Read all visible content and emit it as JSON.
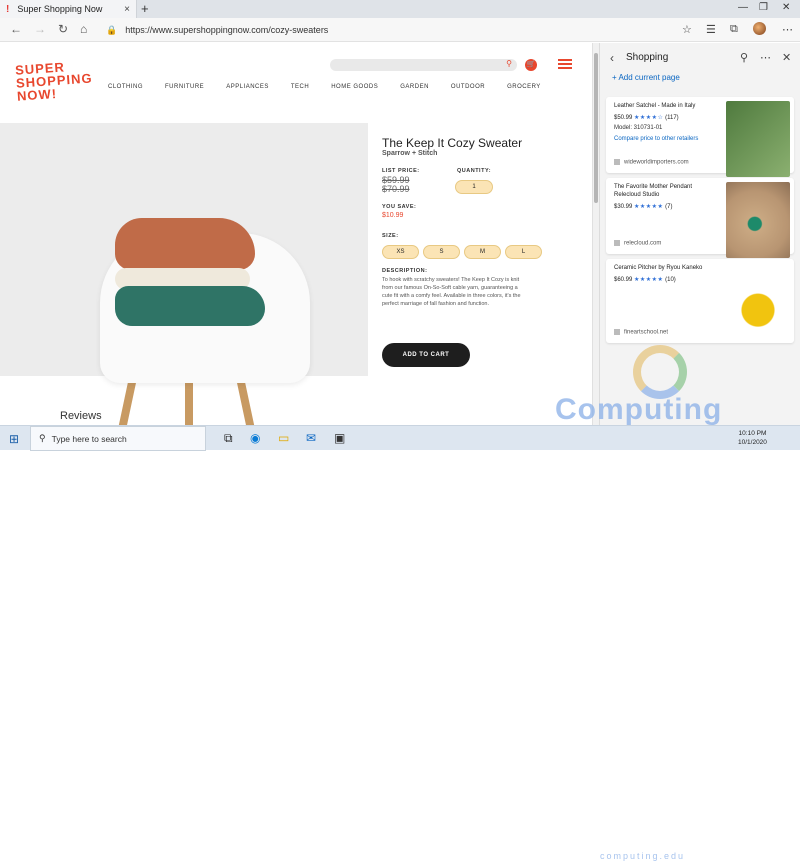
{
  "browser": {
    "tab_title": "Super Shopping Now",
    "tab_close": "×",
    "new_tab": "+",
    "url": "https://www.supershoppingnow.com/cozy-sweaters"
  },
  "site": {
    "logo_lines": [
      "SUPER",
      "SHOPPING",
      "NOW!"
    ],
    "nav": [
      "CLOTHING",
      "FURNITURE",
      "APPLIANCES",
      "TECH",
      "HOME GOODS",
      "GARDEN",
      "OUTDOOR",
      "GROCERY"
    ]
  },
  "product": {
    "title": "The Keep It Cozy Sweater",
    "brand": "Sparrow + Stitch",
    "list_price_label": "LIST PRICE:",
    "list_price_1": "$59.99",
    "list_price_2": "$70.99",
    "quantity_label": "QUANTITY:",
    "quantity": "1",
    "you_save_label": "YOU SAVE:",
    "you_save": "$10.99",
    "size_label": "SIZE:",
    "sizes": [
      "XS",
      "S",
      "M",
      "L"
    ],
    "description_label": "DESCRIPTION:",
    "description": "To hook with scratchy sweaters! The Keep It Cozy is knit from our famous On-So-Soft cable yarn, guaranteeing a cute fit with a comfy feel. Available in three colors, it's the perfect marriage of fall fashion and function.",
    "add_to_cart": "ADD TO CART"
  },
  "reviews_heading": "Reviews",
  "pane": {
    "title": "Shopping",
    "add_current": "Add current page",
    "items": [
      {
        "title": "Leather Satchel - Made in Italy",
        "price": "$50.99",
        "stars": "★★★★☆",
        "reviews": "(117)",
        "model": "Model: 310731-01",
        "compare": "Compare price to other retailers",
        "source": "wideworldimporters.com"
      },
      {
        "title": "The Favorite Mother Pendant Relecloud Studio",
        "price": "$30.99",
        "stars": "★★★★★",
        "reviews": "(7)",
        "source": "relecloud.com"
      },
      {
        "title": "Ceramic Pitcher by Ryou Kaneko",
        "price": "$60.99",
        "stars": "★★★★★",
        "reviews": "(10)",
        "source": "fineartschool.net"
      }
    ]
  },
  "taskbar": {
    "search_placeholder": "Type here to search",
    "time": "10:10 PM",
    "date": "10/1/2020"
  },
  "watermark": {
    "main": "Computing",
    "sub": "computing.edu"
  },
  "colors": {
    "brand": "#e8472e",
    "chip": "#fbe4b5",
    "link": "#0a66c2",
    "star": "#2f6fd6"
  }
}
